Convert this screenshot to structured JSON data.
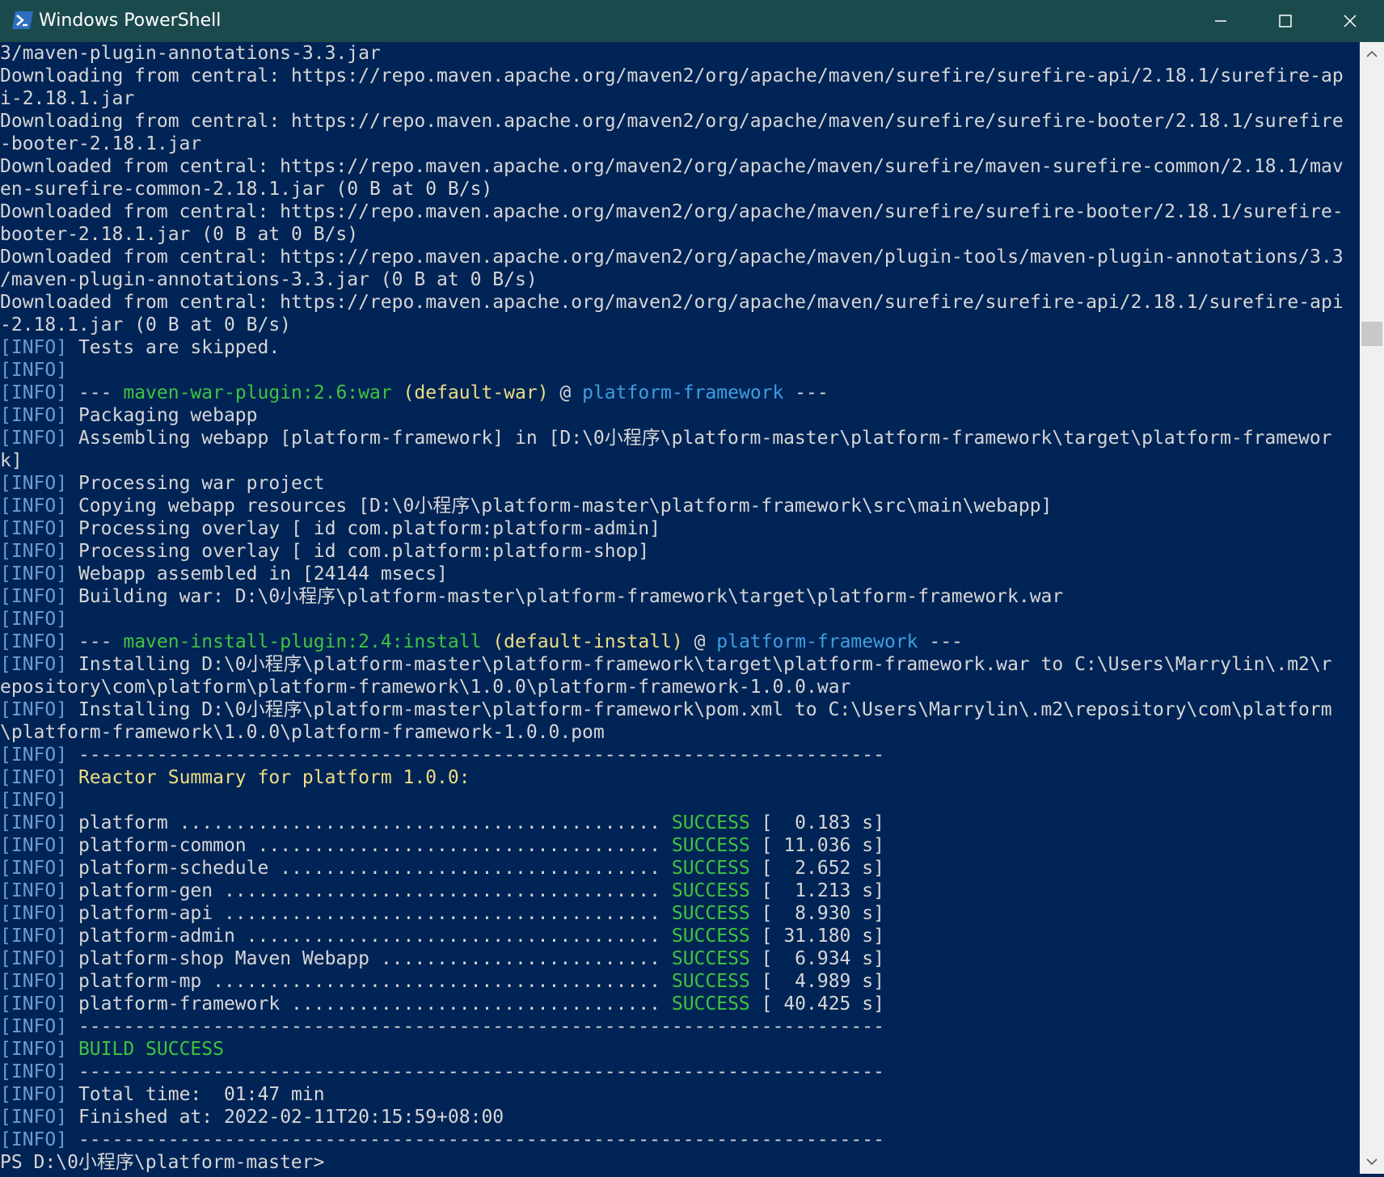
{
  "window": {
    "title": "Windows PowerShell"
  },
  "colors": {
    "console_bg": "#012456",
    "console_fg": "#d6d6d6",
    "titlebar_bg": "#1b4a4d",
    "info_tag": "#6d9bd6",
    "success_green": "#3fc43f",
    "phase_yellow": "#eedd82",
    "project_cyan": "#3f9ee0"
  },
  "titlebar": {
    "minimize_icon": "minimize-icon",
    "maximize_icon": "maximize-icon",
    "close_icon": "close-icon"
  },
  "console": {
    "lines": [
      "3/maven-plugin-annotations-3.3.jar",
      "Downloading from central: https://repo.maven.apache.org/maven2/org/apache/maven/surefire/surefire-api/2.18.1/surefire-ap",
      "i-2.18.1.jar",
      "Downloading from central: https://repo.maven.apache.org/maven2/org/apache/maven/surefire/surefire-booter/2.18.1/surefire",
      "-booter-2.18.1.jar",
      "Downloaded from central: https://repo.maven.apache.org/maven2/org/apache/maven/surefire/maven-surefire-common/2.18.1/mav",
      "en-surefire-common-2.18.1.jar (0 B at 0 B/s)",
      "Downloaded from central: https://repo.maven.apache.org/maven2/org/apache/maven/surefire/surefire-booter/2.18.1/surefire-",
      "booter-2.18.1.jar (0 B at 0 B/s)",
      "Downloaded from central: https://repo.maven.apache.org/maven2/org/apache/maven/plugin-tools/maven-plugin-annotations/3.3",
      "/maven-plugin-annotations-3.3.jar (0 B at 0 B/s)",
      "Downloaded from central: https://repo.maven.apache.org/maven2/org/apache/maven/surefire/surefire-api/2.18.1/surefire-api",
      "-2.18.1.jar (0 B at 0 B/s)",
      "[INFO] Tests are skipped.",
      "[INFO]",
      "[INFO] --- maven-war-plugin:2.6:war (default-war) @ platform-framework ---",
      "[INFO] Packaging webapp",
      "[INFO] Assembling webapp [platform-framework] in [D:\\0小程序\\platform-master\\platform-framework\\target\\platform-framewor",
      "k]",
      "[INFO] Processing war project",
      "[INFO] Copying webapp resources [D:\\0小程序\\platform-master\\platform-framework\\src\\main\\webapp]",
      "[INFO] Processing overlay [ id com.platform:platform-admin]",
      "[INFO] Processing overlay [ id com.platform:platform-shop]",
      "[INFO] Webapp assembled in [24144 msecs]",
      "[INFO] Building war: D:\\0小程序\\platform-master\\platform-framework\\target\\platform-framework.war",
      "[INFO]",
      "[INFO] --- maven-install-plugin:2.4:install (default-install) @ platform-framework ---",
      "[INFO] Installing D:\\0小程序\\platform-master\\platform-framework\\target\\platform-framework.war to C:\\Users\\Marrylin\\.m2\\r",
      "epository\\com\\platform\\platform-framework\\1.0.0\\platform-framework-1.0.0.war",
      "[INFO] Installing D:\\0小程序\\platform-master\\platform-framework\\pom.xml to C:\\Users\\Marrylin\\.m2\\repository\\com\\platform",
      "\\platform-framework\\1.0.0\\platform-framework-1.0.0.pom",
      "[INFO] ------------------------------------------------------------------------",
      "[INFO] Reactor Summary for platform 1.0.0:",
      "[INFO]",
      "[INFO] platform ........................................... SUCCESS [  0.183 s]",
      "[INFO] platform-common .................................... SUCCESS [ 11.036 s]",
      "[INFO] platform-schedule .................................. SUCCESS [  2.652 s]",
      "[INFO] platform-gen ....................................... SUCCESS [  1.213 s]",
      "[INFO] platform-api ....................................... SUCCESS [  8.930 s]",
      "[INFO] platform-admin ..................................... SUCCESS [ 31.180 s]",
      "[INFO] platform-shop Maven Webapp ......................... SUCCESS [  6.934 s]",
      "[INFO] platform-mp ........................................ SUCCESS [  4.989 s]",
      "[INFO] platform-framework ................................. SUCCESS [ 40.425 s]",
      "[INFO] ------------------------------------------------------------------------",
      "[INFO] BUILD SUCCESS",
      "[INFO] ------------------------------------------------------------------------",
      "[INFO] Total time:  01:47 min",
      "[INFO] Finished at: 2022-02-11T20:15:59+08:00",
      "[INFO] ------------------------------------------------------------------------",
      "PS D:\\0小程序\\platform-master>"
    ]
  }
}
